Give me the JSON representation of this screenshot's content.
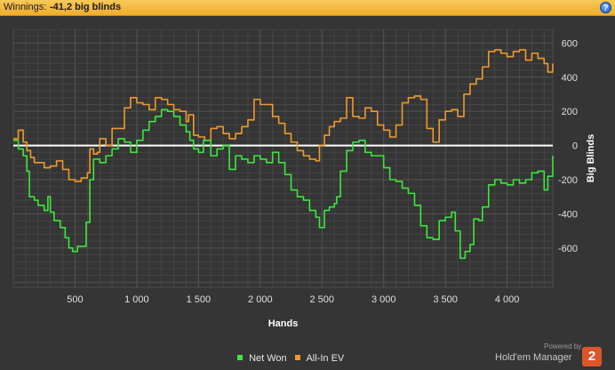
{
  "header": {
    "label": "Winnings:",
    "value": "-41,2 big blinds",
    "help_icon": "?"
  },
  "chart_data": {
    "type": "line",
    "xlabel": "Hands",
    "ylabel": "Big Blinds",
    "xlim": [
      0,
      4370
    ],
    "ylim": [
      -830,
      680
    ],
    "x_ticks": [
      500,
      1000,
      1500,
      2000,
      2500,
      3000,
      3500,
      4000
    ],
    "x_tick_labels": [
      "500",
      "1 000",
      "1 500",
      "2 000",
      "2 500",
      "3 000",
      "3 500",
      "4 000"
    ],
    "y_ticks": [
      600,
      400,
      200,
      0,
      -200,
      -400,
      -600
    ],
    "y_tick_labels": [
      "600",
      "400",
      "200",
      "0",
      "-200",
      "-400",
      "-600"
    ],
    "grid": true,
    "legend_position": "bottom",
    "zero_line_color": "#ffffff",
    "series": [
      {
        "name": "Net Won",
        "color": "#3ce83c",
        "points": [
          [
            0,
            30
          ],
          [
            40,
            -20
          ],
          [
            80,
            -60
          ],
          [
            110,
            -150
          ],
          [
            130,
            -300
          ],
          [
            170,
            -320
          ],
          [
            200,
            -350
          ],
          [
            250,
            -380
          ],
          [
            280,
            -300
          ],
          [
            300,
            -390
          ],
          [
            330,
            -440
          ],
          [
            380,
            -480
          ],
          [
            420,
            -540
          ],
          [
            450,
            -600
          ],
          [
            480,
            -620
          ],
          [
            520,
            -590
          ],
          [
            560,
            -590
          ],
          [
            590,
            -450
          ],
          [
            620,
            -200
          ],
          [
            650,
            -80
          ],
          [
            700,
            -100
          ],
          [
            750,
            -60
          ],
          [
            800,
            -20
          ],
          [
            850,
            40
          ],
          [
            900,
            20
          ],
          [
            950,
            -40
          ],
          [
            1000,
            30
          ],
          [
            1050,
            90
          ],
          [
            1100,
            140
          ],
          [
            1150,
            170
          ],
          [
            1200,
            210
          ],
          [
            1250,
            200
          ],
          [
            1300,
            170
          ],
          [
            1350,
            120
          ],
          [
            1400,
            80
          ],
          [
            1430,
            30
          ],
          [
            1460,
            -20
          ],
          [
            1500,
            -40
          ],
          [
            1540,
            30
          ],
          [
            1600,
            -60
          ],
          [
            1650,
            -20
          ],
          [
            1700,
            0
          ],
          [
            1750,
            -140
          ],
          [
            1800,
            -60
          ],
          [
            1850,
            -80
          ],
          [
            1900,
            -100
          ],
          [
            1950,
            -60
          ],
          [
            2000,
            -80
          ],
          [
            2050,
            -100
          ],
          [
            2100,
            -40
          ],
          [
            2150,
            -100
          ],
          [
            2200,
            -170
          ],
          [
            2250,
            -260
          ],
          [
            2300,
            -300
          ],
          [
            2350,
            -320
          ],
          [
            2400,
            -380
          ],
          [
            2450,
            -420
          ],
          [
            2480,
            -480
          ],
          [
            2520,
            -380
          ],
          [
            2560,
            -360
          ],
          [
            2600,
            -340
          ],
          [
            2620,
            -300
          ],
          [
            2650,
            -150
          ],
          [
            2700,
            -30
          ],
          [
            2750,
            20
          ],
          [
            2800,
            30
          ],
          [
            2850,
            -40
          ],
          [
            2900,
            -60
          ],
          [
            2950,
            -60
          ],
          [
            3000,
            -130
          ],
          [
            3050,
            -200
          ],
          [
            3100,
            -210
          ],
          [
            3150,
            -250
          ],
          [
            3200,
            -280
          ],
          [
            3250,
            -350
          ],
          [
            3300,
            -470
          ],
          [
            3350,
            -540
          ],
          [
            3400,
            -550
          ],
          [
            3450,
            -440
          ],
          [
            3500,
            -420
          ],
          [
            3550,
            -390
          ],
          [
            3580,
            -500
          ],
          [
            3620,
            -660
          ],
          [
            3660,
            -620
          ],
          [
            3700,
            -580
          ],
          [
            3730,
            -430
          ],
          [
            3770,
            -440
          ],
          [
            3800,
            -360
          ],
          [
            3850,
            -230
          ],
          [
            3900,
            -200
          ],
          [
            3950,
            -220
          ],
          [
            4000,
            -230
          ],
          [
            4050,
            -200
          ],
          [
            4100,
            -220
          ],
          [
            4150,
            -200
          ],
          [
            4200,
            -160
          ],
          [
            4250,
            -150
          ],
          [
            4300,
            -260
          ],
          [
            4330,
            -180
          ],
          [
            4370,
            -60
          ]
        ]
      },
      {
        "name": "All-In EV",
        "color": "#f09a2c",
        "points": [
          [
            0,
            40
          ],
          [
            40,
            90
          ],
          [
            80,
            20
          ],
          [
            110,
            -30
          ],
          [
            140,
            -70
          ],
          [
            170,
            -100
          ],
          [
            200,
            -100
          ],
          [
            250,
            -130
          ],
          [
            300,
            -120
          ],
          [
            350,
            -90
          ],
          [
            400,
            -140
          ],
          [
            450,
            -200
          ],
          [
            500,
            -210
          ],
          [
            550,
            -190
          ],
          [
            600,
            -160
          ],
          [
            620,
            -20
          ],
          [
            650,
            -50
          ],
          [
            680,
            -40
          ],
          [
            700,
            40
          ],
          [
            750,
            0
          ],
          [
            800,
            100
          ],
          [
            850,
            100
          ],
          [
            880,
            100
          ],
          [
            900,
            220
          ],
          [
            950,
            280
          ],
          [
            1000,
            250
          ],
          [
            1050,
            240
          ],
          [
            1100,
            210
          ],
          [
            1150,
            280
          ],
          [
            1200,
            270
          ],
          [
            1250,
            240
          ],
          [
            1300,
            210
          ],
          [
            1350,
            200
          ],
          [
            1400,
            140
          ],
          [
            1420,
            180
          ],
          [
            1460,
            60
          ],
          [
            1500,
            50
          ],
          [
            1550,
            30
          ],
          [
            1600,
            100
          ],
          [
            1650,
            110
          ],
          [
            1700,
            70
          ],
          [
            1750,
            40
          ],
          [
            1800,
            70
          ],
          [
            1850,
            110
          ],
          [
            1900,
            150
          ],
          [
            1950,
            270
          ],
          [
            2000,
            240
          ],
          [
            2050,
            240
          ],
          [
            2100,
            170
          ],
          [
            2150,
            130
          ],
          [
            2200,
            70
          ],
          [
            2250,
            20
          ],
          [
            2300,
            -30
          ],
          [
            2350,
            -60
          ],
          [
            2400,
            -80
          ],
          [
            2450,
            -90
          ],
          [
            2480,
            0
          ],
          [
            2520,
            60
          ],
          [
            2560,
            110
          ],
          [
            2600,
            140
          ],
          [
            2650,
            160
          ],
          [
            2700,
            280
          ],
          [
            2750,
            170
          ],
          [
            2800,
            160
          ],
          [
            2850,
            220
          ],
          [
            2900,
            200
          ],
          [
            2950,
            120
          ],
          [
            3000,
            90
          ],
          [
            3050,
            50
          ],
          [
            3100,
            120
          ],
          [
            3150,
            250
          ],
          [
            3200,
            280
          ],
          [
            3250,
            290
          ],
          [
            3300,
            270
          ],
          [
            3350,
            100
          ],
          [
            3400,
            20
          ],
          [
            3450,
            150
          ],
          [
            3500,
            200
          ],
          [
            3550,
            210
          ],
          [
            3600,
            170
          ],
          [
            3650,
            300
          ],
          [
            3700,
            360
          ],
          [
            3750,
            390
          ],
          [
            3800,
            460
          ],
          [
            3850,
            550
          ],
          [
            3900,
            560
          ],
          [
            3950,
            540
          ],
          [
            4000,
            520
          ],
          [
            4050,
            550
          ],
          [
            4100,
            560
          ],
          [
            4150,
            500
          ],
          [
            4200,
            540
          ],
          [
            4250,
            510
          ],
          [
            4300,
            480
          ],
          [
            4330,
            430
          ],
          [
            4370,
            480
          ]
        ]
      }
    ]
  },
  "brand": {
    "powered_by": "Powered by",
    "name": "Hold'em Manager",
    "logo_number": "2"
  }
}
